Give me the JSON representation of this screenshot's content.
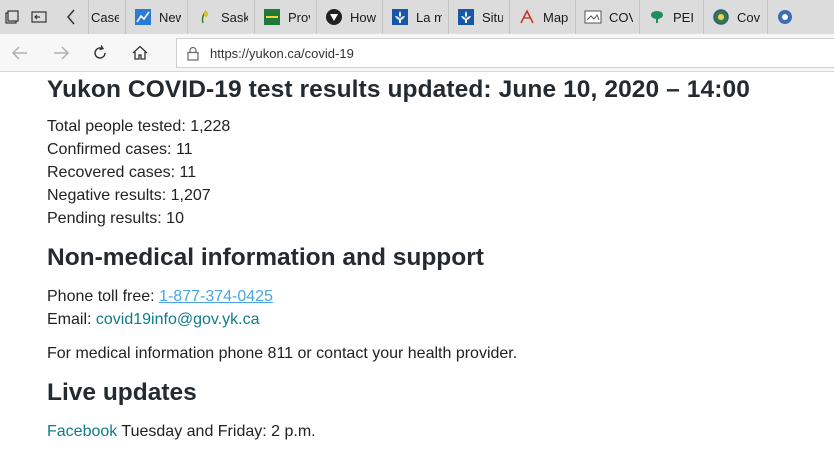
{
  "browser": {
    "tabs": [
      {
        "label": "Case",
        "icon": "page-icon"
      },
      {
        "label": "New",
        "icon": "chart-icon"
      },
      {
        "label": "Sask",
        "icon": "wheat-icon"
      },
      {
        "label": "Prov",
        "icon": "flag-icon"
      },
      {
        "label": "How",
        "icon": "shield-icon"
      },
      {
        "label": "La m",
        "icon": "fleur-de-lis-icon"
      },
      {
        "label": "Situ",
        "icon": "fleur-de-lis-icon"
      },
      {
        "label": "Map",
        "icon": "map-icon"
      },
      {
        "label": "COV",
        "icon": "image-icon"
      },
      {
        "label": "PEI (",
        "icon": "pei-icon"
      },
      {
        "label": "Cov",
        "icon": "globe-icon"
      },
      {
        "label": "",
        "icon": "partial-icon"
      }
    ],
    "url": "https://yukon.ca/covid-19"
  },
  "page": {
    "title": "Yukon COVID-19 test results updated: June 10, 2020 – 14:00",
    "stats": [
      "Total people tested: 1,228",
      "Confirmed cases: 11",
      "Recovered cases: 11",
      "Negative results: 1,207",
      "Pending results: 10"
    ],
    "nonmedical": {
      "heading": "Non-medical information and support",
      "phone_label": "Phone toll free: ",
      "phone": "1-877-374-0425",
      "email_label": "Email: ",
      "email": "covid19info@gov.yk.ca",
      "medical_note": "For medical information phone 811 or contact your health provider."
    },
    "live": {
      "heading": "Live updates",
      "link": "Facebook",
      "schedule": " Tuesday and Friday: 2 p.m."
    }
  },
  "colors": {
    "phone_link": "#4aa6e0",
    "link": "#0f7b8c",
    "heading": "#232a30"
  }
}
